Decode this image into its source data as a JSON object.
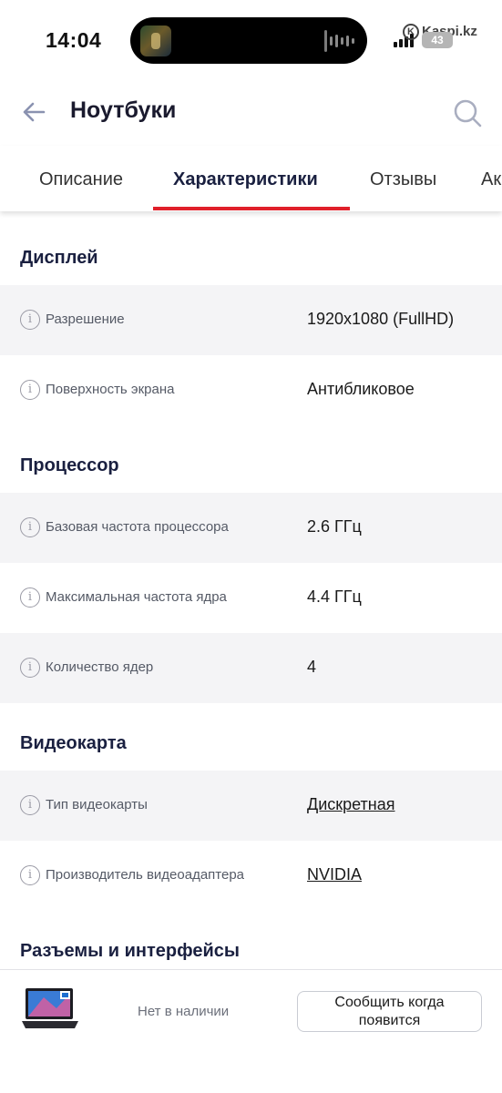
{
  "status_bar": {
    "time": "14:04",
    "battery": "43",
    "brand": "Kaspi.kz"
  },
  "header": {
    "title": "Ноутбуки"
  },
  "tabs": [
    {
      "label": "Описание"
    },
    {
      "label": "Характеристики",
      "active": true
    },
    {
      "label": "Отзывы"
    },
    {
      "label": "Ак"
    }
  ],
  "sections": [
    {
      "title": "Дисплей",
      "rows": [
        {
          "label": "Разрешение",
          "value": "1920x1080 (FullHD)"
        },
        {
          "label": "Поверхность экрана",
          "value": "Антибликовое"
        }
      ]
    },
    {
      "title": "Процессор",
      "rows": [
        {
          "label": "Базовая частота процессора",
          "value": "2.6 ГГц"
        },
        {
          "label": "Максимальная частота ядра",
          "value": "4.4 ГГц"
        },
        {
          "label": "Количество ядер",
          "value": "4"
        }
      ]
    },
    {
      "title": "Видеокарта",
      "rows": [
        {
          "label": "Тип видеокарты",
          "value": "Дискретная"
        },
        {
          "label": "Производитель видеоадаптера",
          "value": "NVIDIA"
        }
      ]
    },
    {
      "title": "Разъемы и интерфейсы",
      "rows": []
    }
  ],
  "bottom_bar": {
    "stock_status": "Нет в наличии",
    "notify_line1": "Сообщить когда",
    "notify_line2": "появится"
  },
  "colors": {
    "accent": "#e0202a",
    "heading": "#1a2040",
    "row_shade": "#f4f4f6"
  }
}
